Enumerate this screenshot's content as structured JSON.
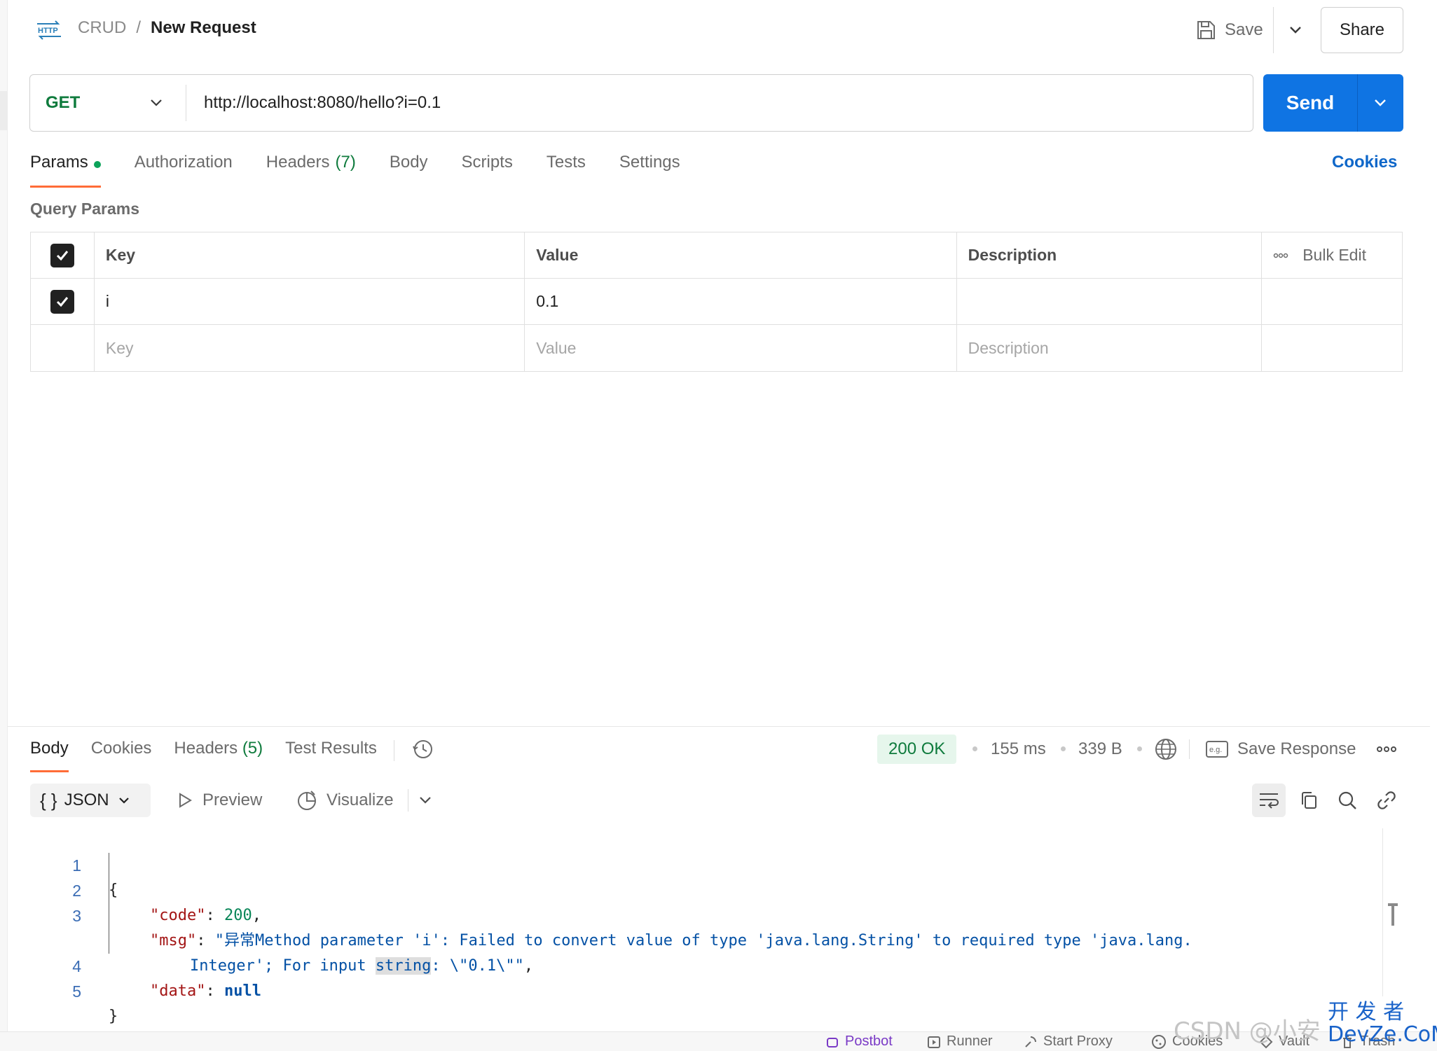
{
  "header": {
    "breadcrumb_parent": "CRUD",
    "breadcrumb_sep": "/",
    "breadcrumb_current": "New Request",
    "save_label": "Save",
    "share_label": "Share",
    "http_icon_text": "HTTP"
  },
  "request": {
    "method": "GET",
    "url": "http://localhost:8080/hello?i=0.1",
    "send_label": "Send"
  },
  "request_tabs": [
    {
      "label": "Params",
      "active": true,
      "has_dot": true
    },
    {
      "label": "Authorization"
    },
    {
      "label": "Headers",
      "count": "(7)"
    },
    {
      "label": "Body"
    },
    {
      "label": "Scripts"
    },
    {
      "label": "Tests"
    },
    {
      "label": "Settings"
    }
  ],
  "cookies_link": "Cookies",
  "query_params": {
    "section_label": "Query Params",
    "columns": {
      "key": "Key",
      "value": "Value",
      "description": "Description",
      "bulk_edit": "Bulk Edit"
    },
    "rows": [
      {
        "checked": true,
        "key": "i",
        "value": "0.1",
        "description": ""
      }
    ],
    "placeholders": {
      "key": "Key",
      "value": "Value",
      "description": "Description"
    }
  },
  "response": {
    "tabs": [
      {
        "label": "Body",
        "active": true
      },
      {
        "label": "Cookies"
      },
      {
        "label": "Headers",
        "count": "(5)"
      },
      {
        "label": "Test Results"
      }
    ],
    "status": "200 OK",
    "time": "155 ms",
    "size": "339 B",
    "save_response_label": "Save Response",
    "format": "JSON",
    "preview_label": "Preview",
    "visualize_label": "Visualize",
    "body": {
      "line_numbers": [
        "1",
        "2",
        "3",
        "",
        "4",
        "5"
      ],
      "open_brace": "{",
      "close_brace": "}",
      "code_key": "\"code\"",
      "code_value": "200",
      "msg_key": "\"msg\"",
      "msg_value_1": "\"异常Method parameter 'i': Failed to convert value of type 'java.lang.String' to required type 'java.lang.",
      "msg_value_2a": "Integer'; For input ",
      "msg_value_2b": "string",
      "msg_value_2c": ": \\\"0.1\\\"\"",
      "data_key": "\"data\"",
      "data_value": "null"
    }
  },
  "statusbar": {
    "items": [
      "Postbot",
      "Runner",
      "Start Proxy",
      "Cookies",
      "Vault",
      "Trash"
    ]
  },
  "watermark": {
    "text": "CSDN @小安",
    "site_top": "开 发 者",
    "site_bottom": "DevZe.CoM"
  },
  "colors": {
    "accent_orange": "#ff6c37",
    "send_blue": "#0f74e3",
    "method_green": "#0f7b3d",
    "status_green_bg": "#e6f6ec"
  },
  "icons": [
    "http-icon",
    "save-icon",
    "chevron-down-icon",
    "check-icon",
    "more-icon",
    "history-icon",
    "globe-icon",
    "eg-icon",
    "braces-icon",
    "play-icon",
    "visualize-icon",
    "wrap-icon",
    "copy-icon",
    "search-icon",
    "link-icon"
  ]
}
